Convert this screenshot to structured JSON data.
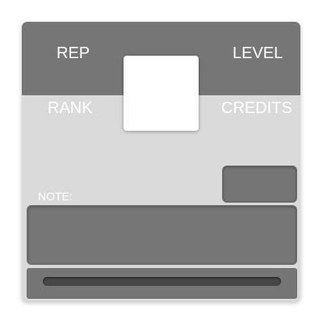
{
  "card": {
    "rep_label": "REP",
    "level_label": "LEVEL",
    "rank_label": "RANK",
    "credits_label": "CREDITS",
    "note_label": "NOTE:"
  },
  "colors": {
    "card_background": "#dadada",
    "top_band": "#767676",
    "panel": "#757575",
    "bar_track": "#474747",
    "label_text": "#ffffff"
  }
}
